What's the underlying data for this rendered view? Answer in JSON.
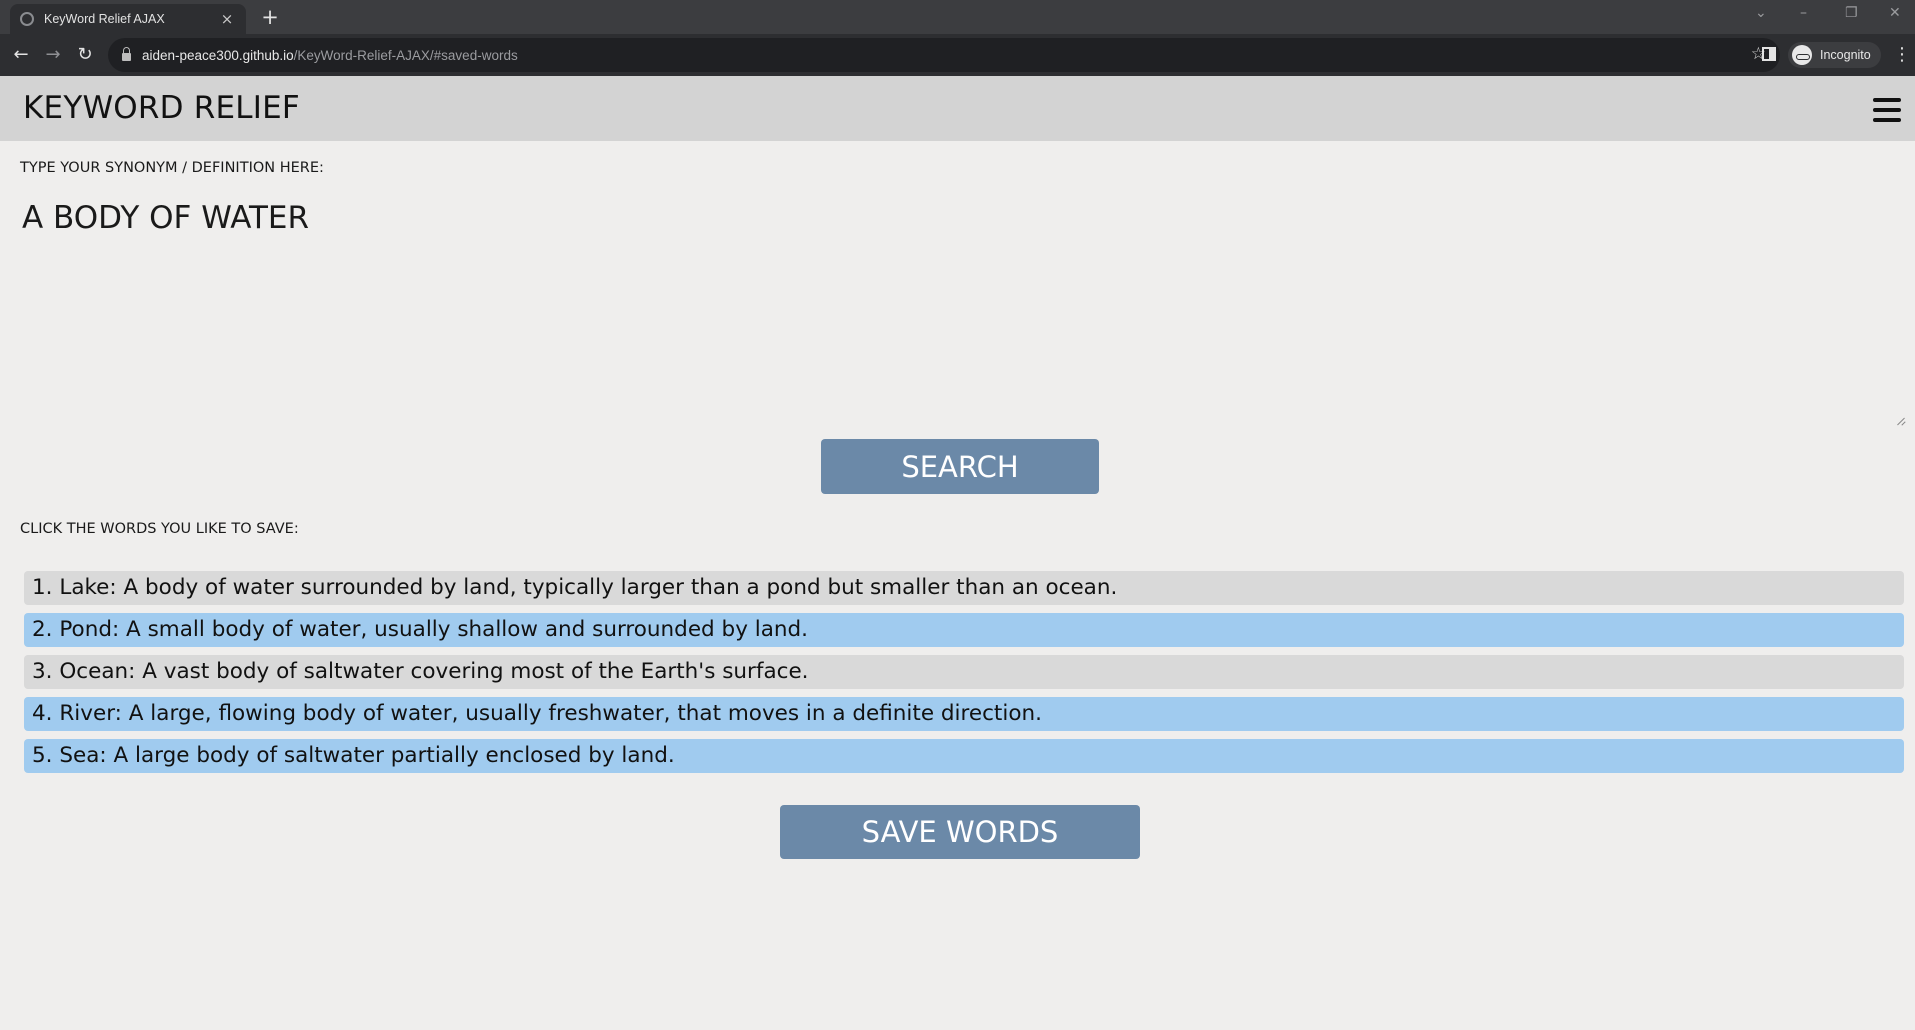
{
  "browser": {
    "tab_title": "KeyWord Relief AJAX",
    "tab_close": "×",
    "new_tab": "+",
    "url_host": "aiden-peace300.github.io",
    "url_path": "/KeyWord-Relief-AJAX/#saved-words",
    "profile_label": "Incognito",
    "icons": [
      "back-icon",
      "forward-icon",
      "reload-icon",
      "lock-icon",
      "star-icon",
      "side-panel-icon",
      "incognito-icon",
      "menu-icon"
    ]
  },
  "header": {
    "title": "KEYWORD RELIEF"
  },
  "search": {
    "label": "TYPE YOUR SYNONYM / DEFINITION HERE:",
    "query": "A BODY OF WATER",
    "button_label": "SEARCH"
  },
  "results": {
    "label": "CLICK THE WORDS YOU LIKE TO SAVE:",
    "items": [
      {
        "text": "1. Lake: A body of water surrounded by land, typically larger than a pond but smaller than an ocean.",
        "selected": false
      },
      {
        "text": "2. Pond: A small body of water, usually shallow and surrounded by land.",
        "selected": true
      },
      {
        "text": "3. Ocean: A vast body of saltwater covering most of the Earth's surface.",
        "selected": false
      },
      {
        "text": "4. River: A large, flowing body of water, usually freshwater, that moves in a definite direction.",
        "selected": true
      },
      {
        "text": "5. Sea: A large body of saltwater partially enclosed by land.",
        "selected": true
      }
    ],
    "save_button_label": "SAVE WORDS"
  },
  "colors": {
    "button": "#6b89a8",
    "item_default": "#d9d9d9",
    "item_selected": "#a0cbef",
    "header_bg": "#d3d3d3",
    "page_bg": "#efeeed"
  }
}
